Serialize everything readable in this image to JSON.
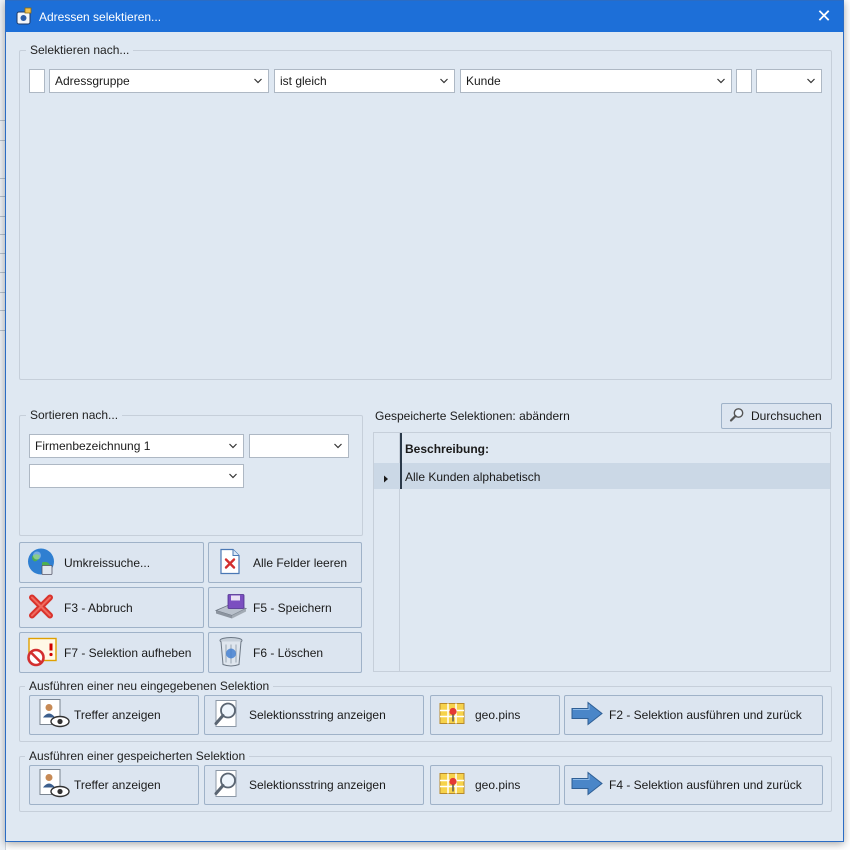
{
  "window": {
    "title": "Adressen selektieren...",
    "close_glyph": "✕"
  },
  "select_group": {
    "label": "Selektieren nach...",
    "field": "Adressgruppe",
    "operator": "ist gleich",
    "value": "Kunde",
    "extra": ""
  },
  "sort_group": {
    "label": "Sortieren nach...",
    "field1": "Firmenbezeichnung 1",
    "field2": "",
    "field3": ""
  },
  "saved": {
    "label": "Gespeicherte Selektionen: abändern",
    "browse_button": "Durchsuchen",
    "column_header": "Beschreibung:",
    "rows": [
      "Alle Kunden alphabetisch"
    ]
  },
  "actions": {
    "radius_search": "Umkreissuche...",
    "clear_fields": "Alle Felder leeren",
    "cancel": "F3 - Abbruch",
    "save": "F5 - Speichern",
    "remove_selection": "F7 - Selektion aufheben",
    "delete": "F6 - Löschen"
  },
  "run_new": {
    "label": "Ausführen einer neu eingegebenen Selektion",
    "show_hits": "Treffer anzeigen",
    "show_string": "Selektionsstring anzeigen",
    "geo": "geo.pins",
    "execute": "F2 - Selektion ausführen und zurück"
  },
  "run_saved": {
    "label": "Ausführen einer gespeicherten Selektion",
    "show_hits": "Treffer anzeigen",
    "show_string": "Selektionsstring anzeigen",
    "geo": "geo.pins",
    "execute": "F4 - Selektion ausführen und zurück"
  },
  "icons": {
    "app": "app-icon",
    "close": "close-icon",
    "dropdown": "chevron-down-icon",
    "search": "magnifier-icon",
    "globe": "globe-icon",
    "clear": "document-x-icon",
    "cancel": "red-x-icon",
    "save": "floppy-icon",
    "remove": "no-entry-icon",
    "delete": "trash-icon",
    "hits": "person-eye-icon",
    "string": "magnifier-page-icon",
    "geo": "map-pin-icon",
    "execute": "arrow-right-icon"
  },
  "colors": {
    "titlebar": "#1d6fd8",
    "dialog_bg": "#dfe8f2",
    "button_bg": "#dce5f0",
    "selected_row": "#cbd8e6"
  }
}
